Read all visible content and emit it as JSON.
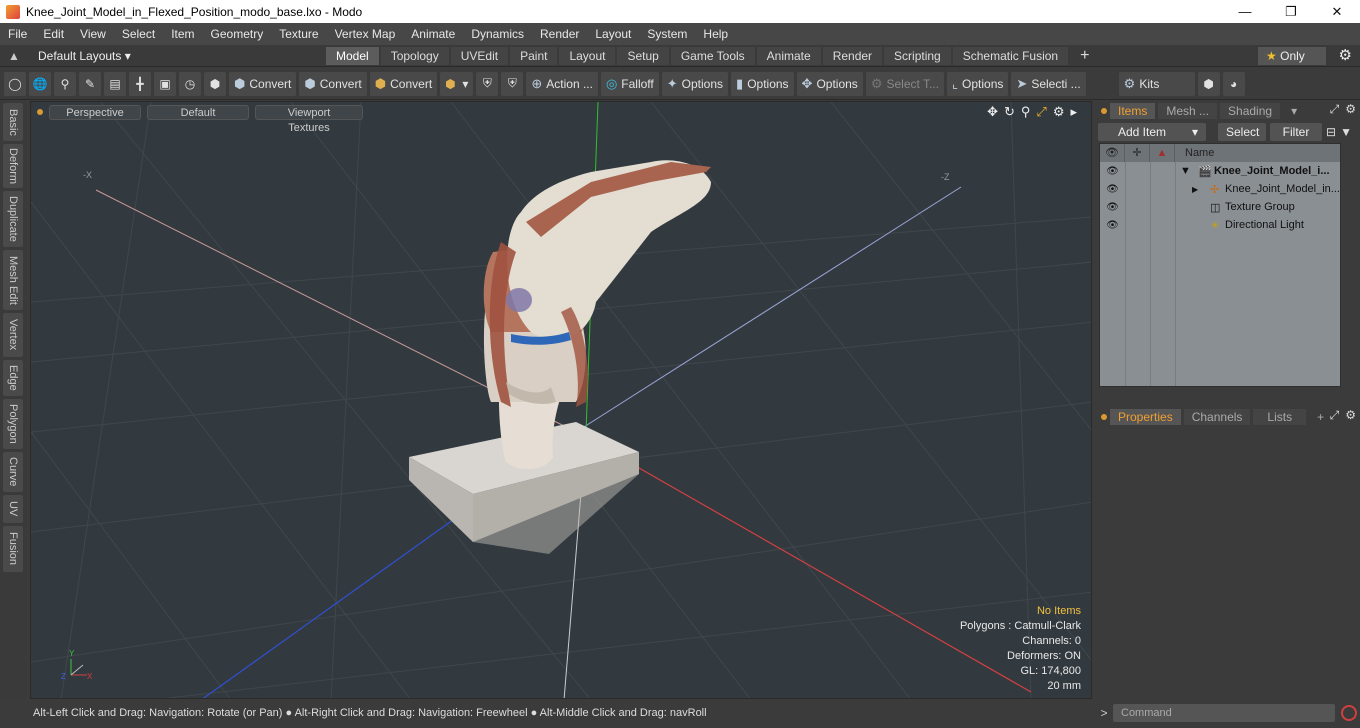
{
  "window": {
    "title": "Knee_Joint_Model_in_Flexed_Position_modo_base.lxo - Modo",
    "controls": [
      "minimize",
      "maximize",
      "close"
    ]
  },
  "menu": [
    "File",
    "Edit",
    "View",
    "Select",
    "Item",
    "Geometry",
    "Texture",
    "Vertex Map",
    "Animate",
    "Dynamics",
    "Render",
    "Layout",
    "System",
    "Help"
  ],
  "layoutbar": {
    "layout_select": "Default Layouts",
    "tabs": [
      "Model",
      "Topology",
      "UVEdit",
      "Paint",
      "Layout",
      "Setup",
      "Game Tools",
      "Animate",
      "Render",
      "Scripting",
      "Schematic Fusion"
    ],
    "active_tab": "Model",
    "only_label": "Only"
  },
  "toolbar": {
    "convert1": "Convert",
    "convert2": "Convert",
    "convert3": "Convert",
    "action": "Action ...",
    "falloff": "Falloff",
    "options1": "Options",
    "options2": "Options",
    "options3": "Options",
    "select_t": "Select T...",
    "options4": "Options",
    "selecti": "Selecti ...",
    "kits": "Kits"
  },
  "left_tabs": [
    "Basic",
    "Deform",
    "Duplicate",
    "Mesh Edit",
    "Vertex",
    "Edge",
    "Polygon",
    "Curve",
    "UV",
    "Fusion"
  ],
  "viewport": {
    "view_mode": "Perspective",
    "shading": "Default",
    "textures": "Viewport Textures",
    "stats": {
      "no_items": "No Items",
      "polygons": "Polygons : Catmull-Clark",
      "channels": "Channels: 0",
      "deformers": "Deformers: ON",
      "gl": "GL: 174,800",
      "scale": "20 mm"
    },
    "axis_labels": {
      "x_neg": "-X",
      "z_neg": "-Z"
    }
  },
  "status": "Alt-Left Click and Drag: Navigation: Rotate (or Pan) ● Alt-Right Click and Drag: Navigation: Freewheel ● Alt-Middle Click and Drag: navRoll",
  "right_panel": {
    "top_tabs": [
      "Items",
      "Mesh ...",
      "Shading"
    ],
    "active_top_tab": "Items",
    "buttons": {
      "add_item": "Add Item",
      "select": "Select",
      "filter": "Filter"
    },
    "list_header": {
      "name": "Name"
    },
    "items": [
      {
        "label": "Knee_Joint_Model_i...",
        "icon": "scene-icon",
        "bold": true
      },
      {
        "label": "Knee_Joint_Model_in...",
        "icon": "mesh-icon",
        "bold": false
      },
      {
        "label": "Texture Group",
        "icon": "texture-icon",
        "bold": false
      },
      {
        "label": "Directional Light",
        "icon": "light-icon",
        "bold": false
      }
    ],
    "bottom_tabs": [
      "Properties",
      "Channels",
      "Lists"
    ],
    "active_bottom_tab": "Properties"
  },
  "command": {
    "placeholder": "Command"
  }
}
